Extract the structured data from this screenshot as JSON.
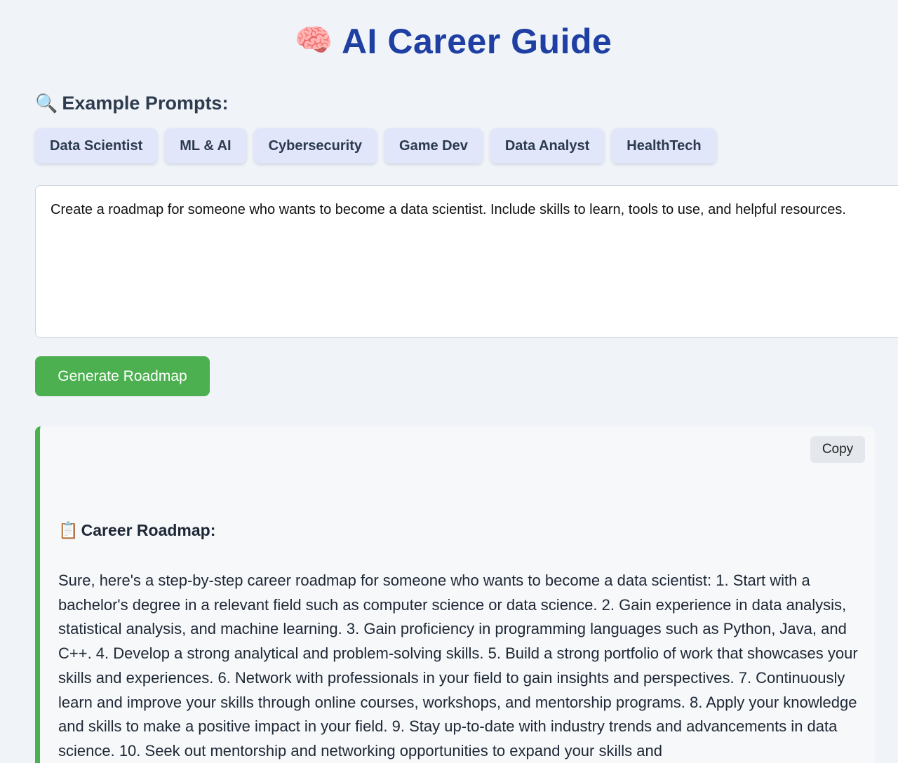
{
  "header": {
    "icon": "brain-icon",
    "title": "AI Career Guide"
  },
  "examples": {
    "icon": "magnifier-icon",
    "heading": "Example Prompts:",
    "chips": [
      "Data Scientist",
      "ML & AI",
      "Cybersecurity",
      "Game Dev",
      "Data Analyst",
      "HealthTech"
    ]
  },
  "prompt": {
    "value": "Create a roadmap for someone who wants to become a data scientist. Include skills to learn, tools to use, and helpful resources."
  },
  "actions": {
    "generate_label": "Generate Roadmap"
  },
  "result": {
    "copy_label": "Copy",
    "heading_icon": "clipboard-icon",
    "heading": "Career Roadmap:",
    "body": "Sure, here's a step-by-step career roadmap for someone who wants to become a data scientist: 1. Start with a bachelor's degree in a relevant field such as computer science or data science. 2. Gain experience in data analysis, statistical analysis, and machine learning. 3. Gain proficiency in programming languages such as Python, Java, and C++. 4. Develop a strong analytical and problem-solving skills. 5. Build a strong portfolio of work that showcases your skills and experiences. 6. Network with professionals in your field to gain insights and perspectives. 7. Continuously learn and improve your skills through online courses, workshops, and mentorship programs. 8. Apply your knowledge and skills to make a positive impact in your field. 9. Stay up-to-date with industry trends and advancements in data science. 10. Seek out mentorship and networking opportunities to expand your skills and"
  },
  "colors": {
    "title": "#1f3fa3",
    "accent_green": "#4cb050",
    "chip_bg": "#e1e6fa",
    "page_bg": "#f0f4f8"
  }
}
